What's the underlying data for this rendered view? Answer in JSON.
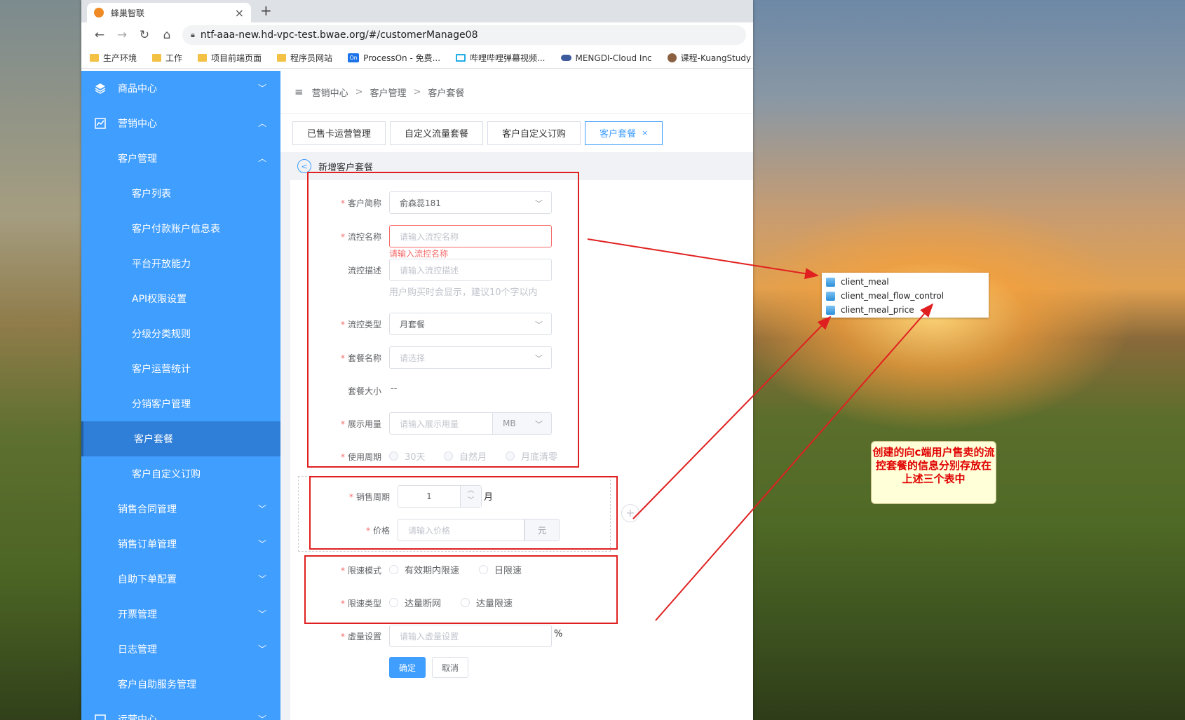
{
  "browser": {
    "tab_title": "蜂巢智联",
    "tab_close": "×",
    "new_tab": "+",
    "url": "ntf-aaa-new.hd-vpc-test.bwae.org/#/customerManage08",
    "bookmarks": [
      "生产环境",
      "工作",
      "项目前端页面",
      "程序员网站",
      "ProcessOn - 免费...",
      "哔哩哔哩弹幕视频...",
      "MENGDI-Cloud Inc",
      "课程-KuangStudy"
    ]
  },
  "sidebar": {
    "items": [
      {
        "label": "商品中心",
        "arrow": "﹀"
      },
      {
        "label": "营销中心",
        "arrow": "︿"
      },
      {
        "label": "客户管理",
        "arrow": "︿"
      },
      {
        "label": "客户列表"
      },
      {
        "label": "客户付款账户信息表"
      },
      {
        "label": "平台开放能力"
      },
      {
        "label": "API权限设置"
      },
      {
        "label": "分级分类规则"
      },
      {
        "label": "客户运营统计"
      },
      {
        "label": "分销客户管理"
      },
      {
        "label": "客户套餐"
      },
      {
        "label": "客户自定义订购"
      },
      {
        "label": "销售合同管理",
        "arrow": "﹀"
      },
      {
        "label": "销售订单管理",
        "arrow": "﹀"
      },
      {
        "label": "自助下单配置",
        "arrow": "﹀"
      },
      {
        "label": "开票管理",
        "arrow": "﹀"
      },
      {
        "label": "日志管理",
        "arrow": "﹀"
      },
      {
        "label": "客户自助服务管理"
      },
      {
        "label": "运营中心",
        "arrow": "﹀"
      }
    ]
  },
  "breadcrumb": {
    "menu_icon": "≡",
    "items": [
      "营销中心",
      "客户管理",
      "客户套餐"
    ],
    "sep": ">"
  },
  "page_tabs": [
    "已售卡运营管理",
    "自定义流量套餐",
    "客户自定义订购",
    "客户套餐"
  ],
  "page_tab_close": "×",
  "subheader": {
    "back": "<",
    "title": "新增客户套餐"
  },
  "form": {
    "customer": {
      "label": "客户简称",
      "value": "俞森蕊181"
    },
    "flow_name": {
      "label": "流控名称",
      "placeholder": "请输入流控名称",
      "error": "请输入流控名称"
    },
    "flow_desc": {
      "label": "流控描述",
      "placeholder": "请输入流控描述",
      "hint": "用户购买时会显示，建议10个字以内"
    },
    "flow_type": {
      "label": "流控类型",
      "value": "月套餐"
    },
    "package_name": {
      "label": "套餐名称",
      "placeholder": "请选择"
    },
    "package_size": {
      "label": "套餐大小",
      "value": "--"
    },
    "display_usage": {
      "label": "展示用量",
      "placeholder": "请输入展示用量",
      "unit": "MB"
    },
    "usage_cycle": {
      "label": "使用周期",
      "options": [
        "30天",
        "自然月",
        "月底清零"
      ]
    },
    "sales_cycle": {
      "label": "销售周期",
      "value": "1",
      "unit": "月"
    },
    "price": {
      "label": "价格",
      "placeholder": "请输入价格",
      "unit": "元"
    },
    "add_icon": "+",
    "limit_mode": {
      "label": "限速模式",
      "options": [
        "有效期内限速",
        "日限速"
      ]
    },
    "limit_type": {
      "label": "限速类型",
      "options": [
        "达量断网",
        "达量限速"
      ]
    },
    "virtual": {
      "label": "虚量设置",
      "placeholder": "请输入虚量设置",
      "unit": "%"
    },
    "confirm": "确定",
    "cancel": "取消"
  },
  "annotation": {
    "tables": [
      "client_meal",
      "client_meal_flow_control",
      "client_meal_price"
    ],
    "note": "创建的向c端用户售卖的流控套餐的信息分别存放在上述三个表中"
  }
}
